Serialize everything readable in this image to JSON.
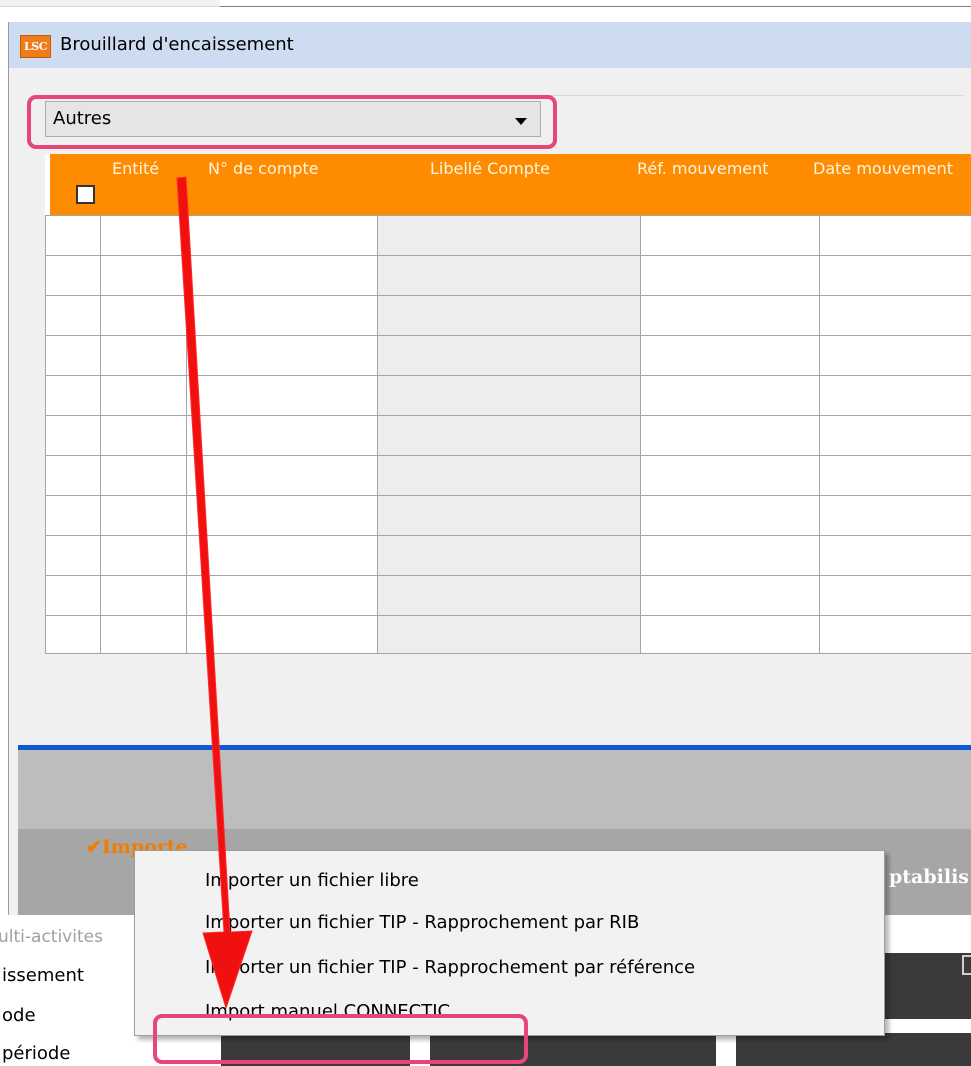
{
  "window": {
    "logo_text": "LSC",
    "title": "Brouillard d'encaissement"
  },
  "filter_combo": {
    "value": "Autres"
  },
  "grid": {
    "columns": [
      "Entité",
      "N° de compte",
      "Libellé Compte",
      "Réf. mouvement",
      "Date mouvement"
    ],
    "row_count": 11
  },
  "footer": {
    "import_label": "Importe",
    "compta_label": "ptabilis"
  },
  "context_menu": {
    "items": [
      "Importer un fichier libre",
      "Importer un fichier TIP - Rapprochement par RIB",
      "Importer un fichier TIP - Rapprochement par référence",
      "Import manuel CONNECTIC"
    ]
  },
  "background_sidebar": [
    "ulti-activites",
    "issement",
    "ode",
    "période"
  ],
  "annotation": {
    "highlight_color": "#e8457a",
    "arrow_color": "#f01010"
  },
  "colors": {
    "header_orange": "#ff8c00",
    "title_bar": "#cddcf0",
    "accent_blue": "#0e59d0"
  }
}
